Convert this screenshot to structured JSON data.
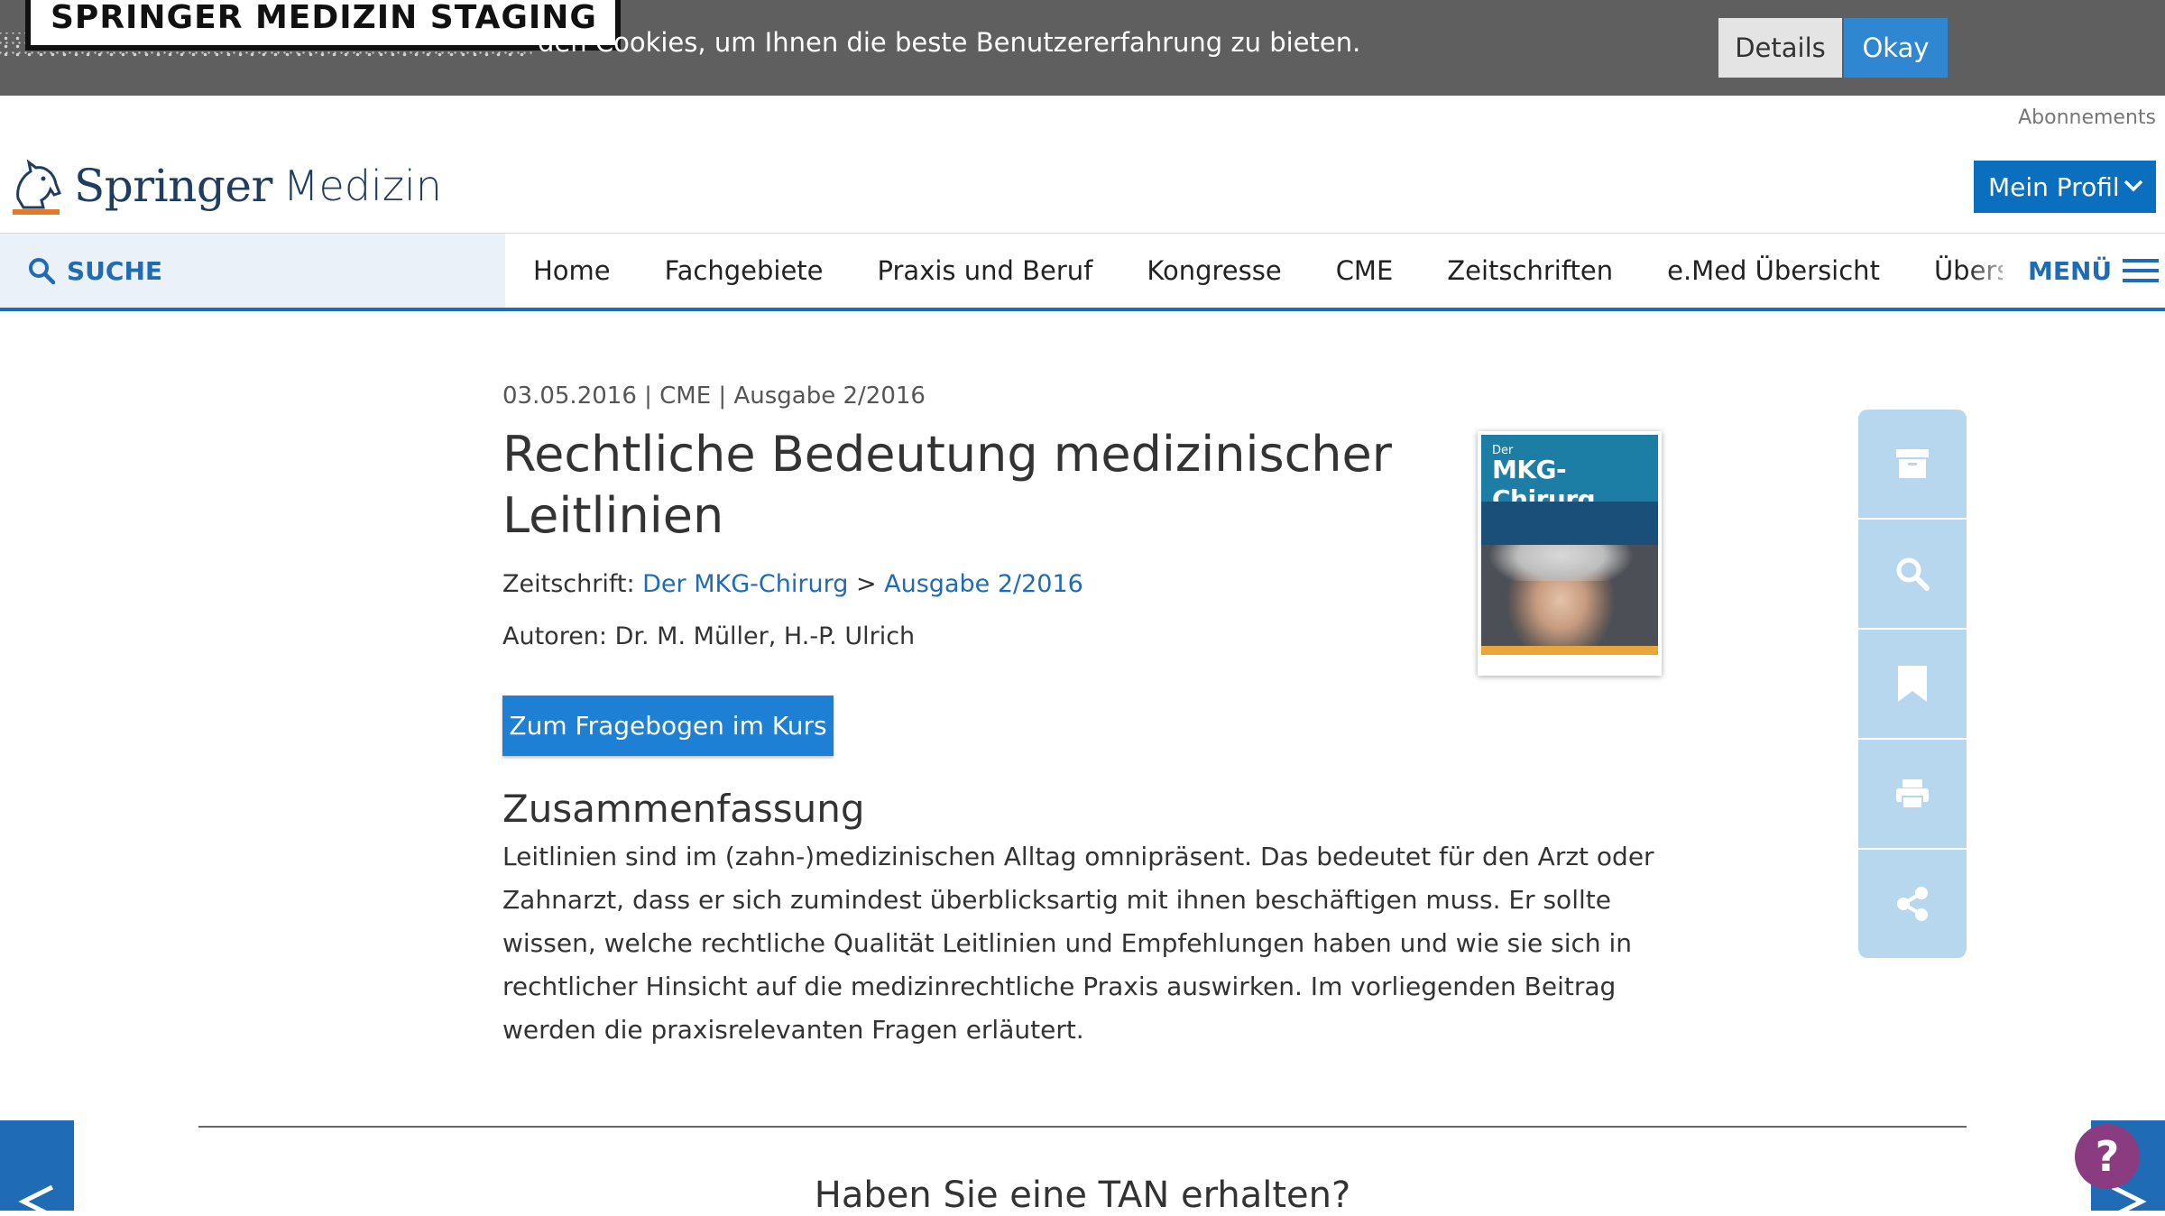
{
  "cookie_bar": {
    "staging_label": "SPRINGER MEDIZIN STAGING",
    "message": "den Cookies, um Ihnen die beste Benutzererfahrung zu bieten.",
    "details_label": "Details",
    "okay_label": "Okay"
  },
  "header": {
    "abonnements": "Abonnements",
    "logo_springer": "Springer",
    "logo_medizin": "Medizin",
    "mein_profil": "Mein Profil"
  },
  "nav": {
    "search_label": "SUCHE",
    "items": [
      "Home",
      "Fachgebiete",
      "Praxis und Beruf",
      "Kongresse",
      "CME",
      "Zeitschriften",
      "e.Med Übersicht",
      "Übersicht Slides"
    ],
    "menu_label": "MENÜ"
  },
  "article": {
    "meta": "03.05.2016 | CME | Ausgabe 2/2016",
    "title": "Rechtliche Bedeutung medizinischer Leitlinien",
    "journal_label": "Zeitschrift:",
    "journal_name": "Der MKG-Chirurg",
    "journal_sep": ">",
    "issue": "Ausgabe 2/2016",
    "authors_label": "Autoren:",
    "authors": "Dr. M. Müller, H.-P. Ulrich",
    "cta_label": "Zum Fragebogen im Kurs",
    "summary_heading": "Zusammenfassung",
    "summary_text": "Leitlinien sind im (zahn-)medizinischen Alltag omnipräsent. Das bedeutet für den Arzt oder Zahnarzt, dass er sich zumindest überblicksartig mit ihnen beschäftigen muss. Er sollte wissen, welche rechtliche Qualität Leitlinien und Empfehlungen haben und wie sie sich in rechtlicher Hinsicht auf die medizinrechtliche Praxis auswirken. Im vorliegenden Beitrag werden die praxisrelevanten Fragen erläutert."
  },
  "cover": {
    "der": "Der",
    "name": "MKG-Chirurg"
  },
  "side_tools": [
    "archive-icon",
    "search-icon",
    "bookmark-icon",
    "print-icon",
    "share-icon"
  ],
  "bottom": {
    "tan_heading": "Haben Sie eine TAN erhalten?"
  },
  "colors": {
    "cookie_bg": "#5f5f5f",
    "primary_blue": "#1f6bb5",
    "button_blue": "#1d80d4",
    "tool_bg": "#b7d7ee",
    "help_purple": "#8b3c80"
  }
}
